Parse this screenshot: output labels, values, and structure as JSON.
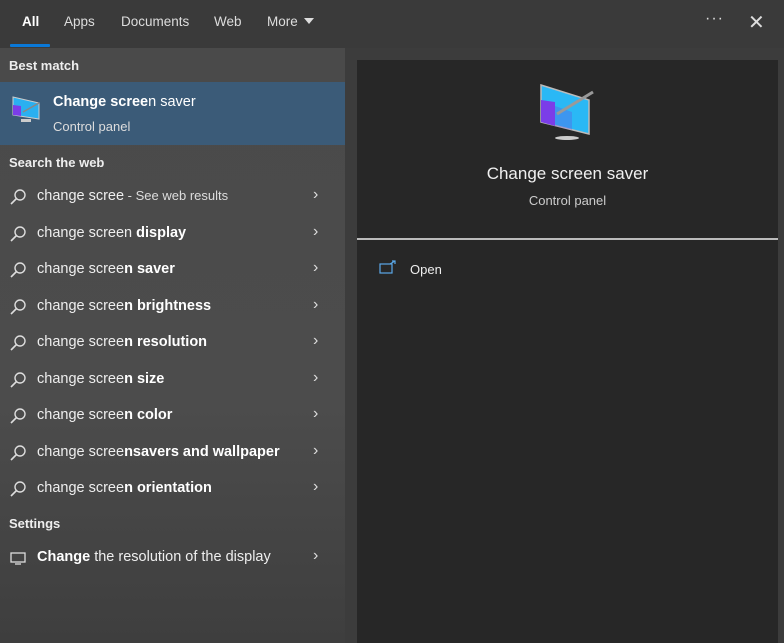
{
  "tabs": [
    {
      "label": "All"
    },
    {
      "label": "Apps"
    },
    {
      "label": "Documents"
    },
    {
      "label": "Web"
    },
    {
      "label": "More"
    }
  ],
  "header": {
    "more_options": "···",
    "close": "✕"
  },
  "best_match": {
    "heading": "Best match",
    "title_bold": "Change scree",
    "title_rest": "n saver",
    "subtitle": "Control panel"
  },
  "web": {
    "heading": "Search the web",
    "items": [
      {
        "prefix": "change scree",
        "bold": "",
        "suffix": " - See web results"
      },
      {
        "prefix": "change screen",
        "bold": " display"
      },
      {
        "prefix": "change scree",
        "bold": "n saver"
      },
      {
        "prefix": "change scree",
        "bold": "n brightness"
      },
      {
        "prefix": "change scree",
        "bold": "n resolution"
      },
      {
        "prefix": "change scree",
        "bold": "n size"
      },
      {
        "prefix": "change scree",
        "bold": "n color"
      },
      {
        "prefix": "change scree",
        "bold": "nsavers and wallpaper"
      },
      {
        "prefix": "change scree",
        "bold": "n orientation"
      }
    ]
  },
  "settings": {
    "heading": "Settings",
    "item_bold": "Change",
    "item_rest": " the resolution of the display"
  },
  "preview": {
    "title": "Change screen saver",
    "subtitle": "Control panel",
    "open_label": "Open"
  },
  "colors": {
    "accent": "#0a78d7",
    "selected": "#3b5b78"
  }
}
